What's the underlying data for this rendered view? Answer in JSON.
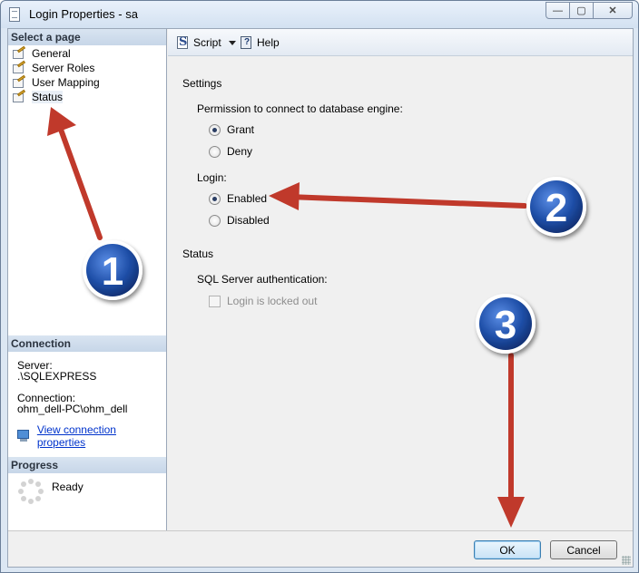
{
  "window": {
    "title": "Login Properties - sa",
    "controls": {
      "minimize": "—",
      "maximize": "▢",
      "close": "✕"
    }
  },
  "sidebar": {
    "select_header": "Select a page",
    "pages": [
      {
        "label": "General",
        "icon": "page-wand-icon"
      },
      {
        "label": "Server Roles",
        "icon": "page-wand-icon"
      },
      {
        "label": "User Mapping",
        "icon": "page-wand-icon"
      },
      {
        "label": "Status",
        "icon": "page-wand-icon",
        "selected": true
      }
    ],
    "connection_header": "Connection",
    "server_label": "Server:",
    "server_value": ".\\SQLEXPRESS",
    "connection_label": "Connection:",
    "connection_value": "ohm_dell-PC\\ohm_dell",
    "view_props_link": "View connection properties",
    "progress_header": "Progress",
    "progress_status": "Ready"
  },
  "toolbar": {
    "script_label": "Script",
    "help_label": "Help"
  },
  "main": {
    "settings_label": "Settings",
    "permission_label": "Permission to connect to database engine:",
    "permission_options": {
      "grant": "Grant",
      "deny": "Deny"
    },
    "permission_selected": "grant",
    "login_label": "Login:",
    "login_options": {
      "enabled": "Enabled",
      "disabled": "Disabled"
    },
    "login_selected": "enabled",
    "status_label": "Status",
    "sql_auth_label": "SQL Server authentication:",
    "locked_out_label": "Login is locked out",
    "locked_out_checked": false
  },
  "footer": {
    "ok_label": "OK",
    "cancel_label": "Cancel"
  },
  "annotations": {
    "badge_1": "1",
    "badge_2": "2",
    "badge_3": "3",
    "arrow_color": "#c0392b",
    "badge_color": "#1f4fa8"
  }
}
